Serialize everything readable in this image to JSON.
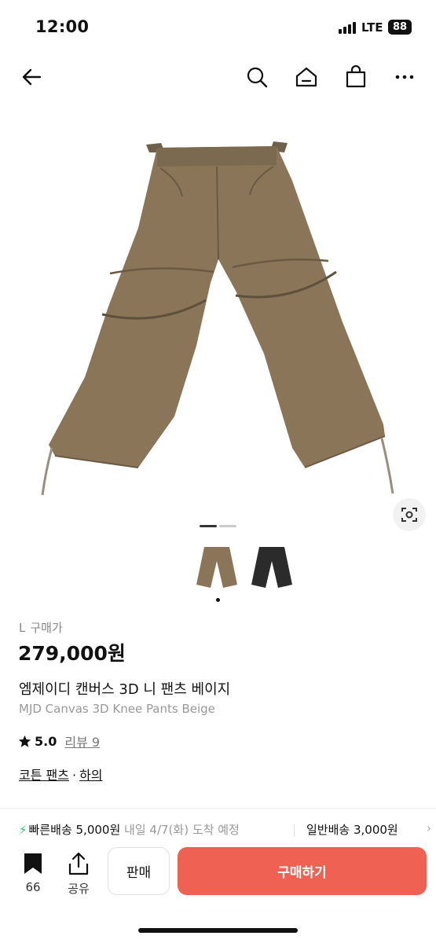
{
  "status": {
    "time": "12:00",
    "network": "LTE",
    "battery": "88"
  },
  "nav": {
    "icons": [
      "back-arrow-icon",
      "search-icon",
      "home-icon",
      "shopping-bag-icon",
      "more-icon"
    ]
  },
  "gallery": {
    "current_page": 1,
    "total_pages": 2,
    "lens_icon": "lens-search-icon"
  },
  "product": {
    "size": "L",
    "price_label": "구매가",
    "price": "279,000원",
    "name_ko": "엠제이디 캔버스 3D 니 팬츠 베이지",
    "name_en": "MJD Canvas 3D Knee Pants Beige",
    "rating": "5.0",
    "reviews": "리뷰 9",
    "tags": [
      "코튼 팬츠",
      "하의"
    ],
    "tag_separator": "·"
  },
  "shipping": {
    "fast_label": "빠른배송 5,000원",
    "fast_detail": "내일 4/7(화) 도착 예정",
    "normal_label": "일반배송 3,000원"
  },
  "actions": {
    "bookmark_count": "66",
    "share_label": "공유",
    "sell_label": "판매",
    "buy_label": "구매하기"
  },
  "colors": {
    "accent": "#ef6253",
    "fast_shipping": "#2ac36b",
    "pants_beige": "#8a7559",
    "pants_black": "#2b2b2b"
  }
}
